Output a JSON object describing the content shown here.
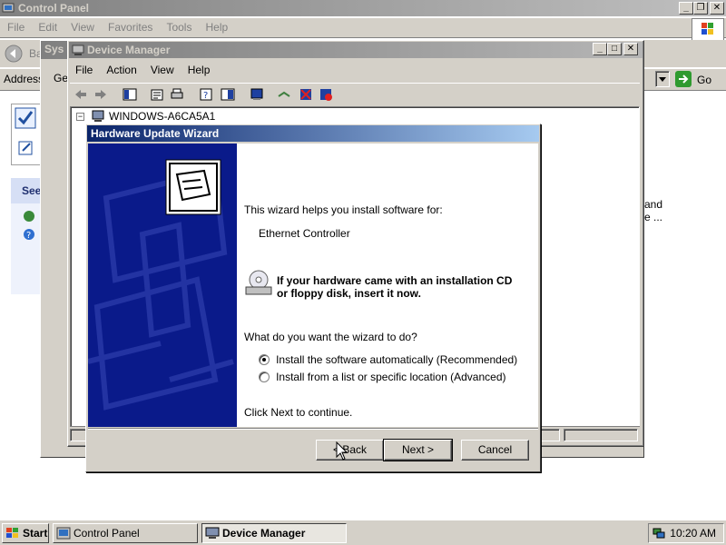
{
  "control_panel": {
    "title": "Control Panel",
    "menu": [
      "File",
      "Edit",
      "View",
      "Favorites",
      "Tools",
      "Help"
    ],
    "back_label": "Ba",
    "address_label": "Address",
    "go_label": "Go",
    "sidebar_see": "See",
    "right_text_1": "and",
    "right_text_2": "e ...",
    "window_buttons": [
      "_",
      "❐",
      "✕"
    ]
  },
  "system_properties": {
    "title": "Sys",
    "tab": "Ge"
  },
  "device_manager": {
    "title": "Device Manager",
    "menu": [
      "File",
      "Action",
      "View",
      "Help"
    ],
    "tree_root": "WINDOWS-A6CA5A1",
    "window_buttons": [
      "_",
      "□",
      "✕"
    ]
  },
  "wizard": {
    "title": "Hardware Update Wizard",
    "intro": "This wizard helps you install software for:",
    "device": "Ethernet Controller",
    "cd_hint": "If your hardware came with an installation CD or floppy disk, insert it now.",
    "question": "What do you want the wizard to do?",
    "options": [
      {
        "label": "Install the software automatically (Recommended)",
        "selected": true
      },
      {
        "label": "Install from a list or specific location (Advanced)",
        "selected": false
      }
    ],
    "continue_text": "Click Next to continue.",
    "buttons": {
      "back": "< Back",
      "next": "Next >",
      "cancel": "Cancel"
    }
  },
  "taskbar": {
    "start": "Start",
    "tasks": [
      {
        "label": "Control Panel",
        "active": false
      },
      {
        "label": "Device Manager",
        "active": true
      }
    ],
    "clock": "10:20 AM"
  },
  "colors": {
    "face": "#d4d0c8",
    "active_title": "#0a246a",
    "inactive_title": "#808080",
    "wizard_sidebar": "#0a1a8a"
  }
}
